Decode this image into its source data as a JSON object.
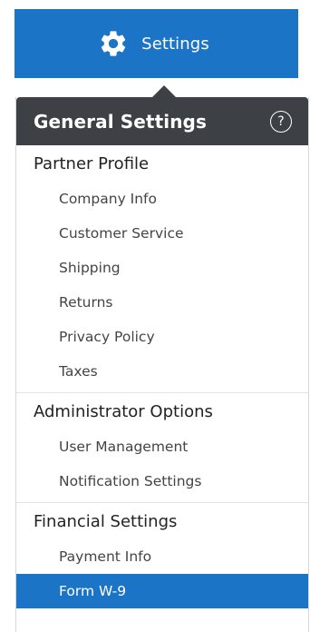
{
  "header_button": {
    "label": "Settings",
    "icon": "gear-icon"
  },
  "panel": {
    "title": "General Settings",
    "help_icon": "?",
    "sections": [
      {
        "title": "Partner Profile",
        "items": [
          {
            "label": "Company Info"
          },
          {
            "label": "Customer Service"
          },
          {
            "label": "Shipping"
          },
          {
            "label": "Returns"
          },
          {
            "label": "Privacy Policy"
          },
          {
            "label": "Taxes"
          }
        ]
      },
      {
        "title": "Administrator Options",
        "items": [
          {
            "label": "User Management"
          },
          {
            "label": "Notification Settings"
          }
        ]
      },
      {
        "title": "Financial Settings",
        "items": [
          {
            "label": "Payment Info"
          },
          {
            "label": "Form W-9",
            "active": true
          }
        ]
      }
    ]
  },
  "colors": {
    "accent": "#1b74c5",
    "header_bg": "#3d4044",
    "divider": "#e3e3e3"
  }
}
